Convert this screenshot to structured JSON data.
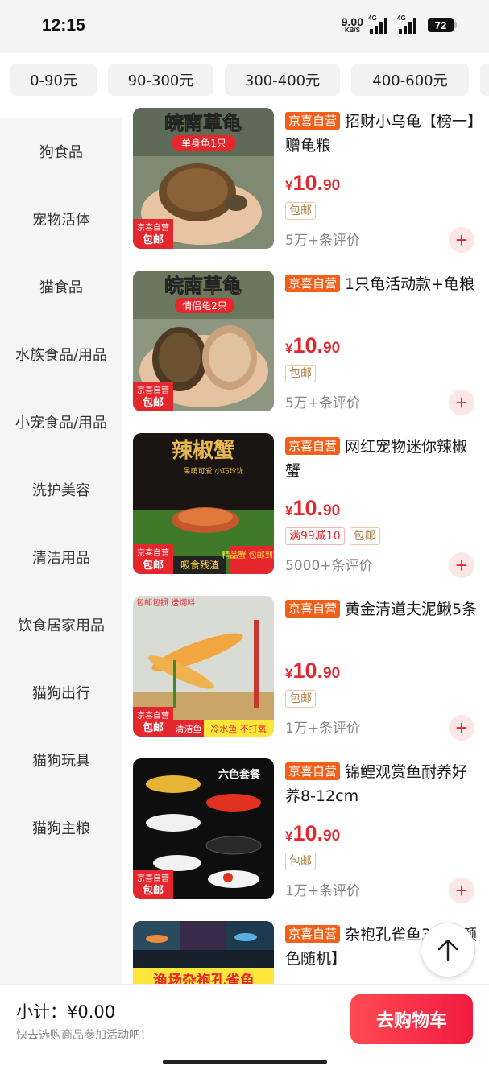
{
  "status_bar": {
    "time": "12:15",
    "net_speed": "9.00",
    "net_unit": "KB/S",
    "signal1_label": "4G",
    "signal2_label": "4G",
    "battery": "72"
  },
  "price_filters": [
    "0-90元",
    "90-300元",
    "300-400元",
    "400-600元"
  ],
  "sidebar": {
    "items": [
      "狗食品",
      "宠物活体",
      "猫食品",
      "水族食品/用品",
      "小宠食品/用品",
      "洗护美容",
      "清洁用品",
      "饮食居家用品",
      "猫狗出行",
      "猫狗玩具",
      "猫狗主粮"
    ]
  },
  "products": [
    {
      "tag": "京喜自营",
      "title": "招财小乌龟【榜一】赠龟粮",
      "price_currency": "¥",
      "price_int": "10.",
      "price_dec": "90",
      "badges": [
        "包邮"
      ],
      "reviews": "5万+条评价",
      "image_title": "皖南草龟",
      "image_sub": "单身龟1只",
      "image_corner_top": "京喜自营",
      "image_corner_bottom": "包邮"
    },
    {
      "tag": "京喜自营",
      "title": "1只龟活动款+龟粮",
      "price_currency": "¥",
      "price_int": "10.",
      "price_dec": "90",
      "badges": [
        "包邮"
      ],
      "reviews": "5万+条评价",
      "image_title": "皖南草龟",
      "image_sub": "情侣龟2只",
      "image_corner_top": "京喜自营",
      "image_corner_bottom": "包邮"
    },
    {
      "tag": "京喜自营",
      "title": "网红宠物迷你辣椒蟹",
      "price_currency": "¥",
      "price_int": "10.",
      "price_dec": "90",
      "badges": [
        "满99减10",
        "包邮"
      ],
      "reviews": "5000+条评价",
      "image_title": "辣椒蟹",
      "image_sub": "呆萌可爱 小巧玲珑",
      "image_strip": "吸食残渣",
      "image_box": "精品蟹 包邮到家",
      "image_corner_top": "京喜自营",
      "image_corner_bottom": "包邮"
    },
    {
      "tag": "京喜自营",
      "title": "黄金清道夫泥鳅5条",
      "price_currency": "¥",
      "price_int": "10.",
      "price_dec": "90",
      "badges": [
        "包邮"
      ],
      "reviews": "1万+条评价",
      "image_top_left": "包邮包损 送饲料",
      "image_strip_a": "清洁鱼",
      "image_strip_b": "冷水鱼 不打氧",
      "image_corner_top": "京喜自营",
      "image_corner_bottom": "包邮"
    },
    {
      "tag": "京喜自营",
      "title": "锦鲤观赏鱼耐养好养8-12cm",
      "price_currency": "¥",
      "price_int": "10.",
      "price_dec": "90",
      "badges": [
        "包邮"
      ],
      "reviews": "1万+条评价",
      "image_title": "六色套餐",
      "image_corner_top": "京喜自营",
      "image_corner_bottom": "包邮"
    },
    {
      "tag": "京喜自营",
      "title": "杂袍孔雀鱼3条【颜色随机】",
      "image_title": "渔场杂袍孔雀鱼"
    }
  ],
  "footer": {
    "subtotal": "小计：¥0.00",
    "hint": "快去选购商品参加活动吧！",
    "cart_button": "去购物车"
  },
  "colors": {
    "accent": "#e4262d",
    "tag": "#f0601a",
    "sidebar_bg": "#f5f5f5"
  }
}
